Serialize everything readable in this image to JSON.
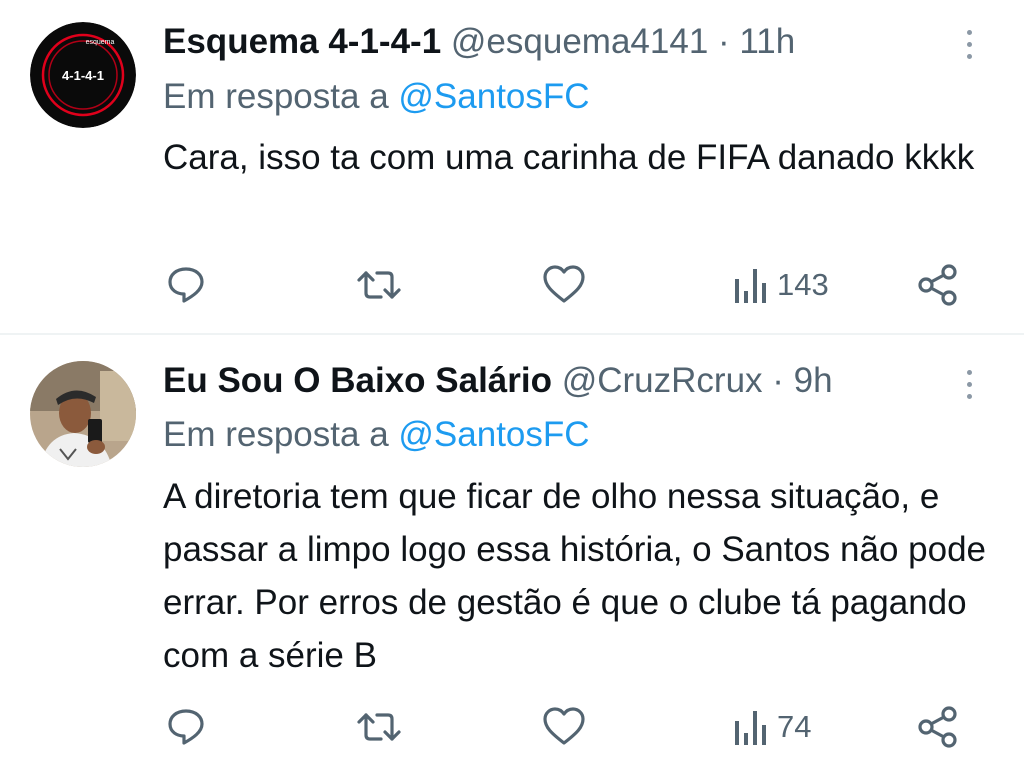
{
  "tweets": [
    {
      "avatar": {
        "text_top": "esquema",
        "text_main": "4-1-4-1"
      },
      "name": "Esquema 4-1-4-1",
      "handle": "@esquema4141",
      "separator": "·",
      "time": "11h",
      "reply_prefix": "Em resposta a ",
      "reply_handle": "@SantosFC",
      "text": "Cara, isso ta com uma carinha de FIFA danado kkkk",
      "views": "143",
      "icons": [
        "reply-icon",
        "retweet-icon",
        "like-icon",
        "views-icon",
        "share-icon",
        "more-icon"
      ]
    },
    {
      "name": "Eu Sou O Baixo Salário",
      "handle": "@CruzRcrux",
      "separator": "·",
      "time": "9h",
      "reply_prefix": "Em resposta a ",
      "reply_handle": "@SantosFC",
      "text": "A diretoria tem que ficar de olho nessa situação, e passar a limpo logo essa história, o Santos não pode errar. Por erros de gestão é que o clube tá pagando com a série B",
      "views": "74",
      "icons": [
        "reply-icon",
        "retweet-icon",
        "like-icon",
        "views-icon",
        "share-icon",
        "more-icon"
      ]
    }
  ],
  "colors": {
    "text": "#0f1419",
    "muted": "#536471",
    "link": "#1d9bf0",
    "divider": "#eff3f4",
    "avatar_ring": "#e0001b"
  }
}
